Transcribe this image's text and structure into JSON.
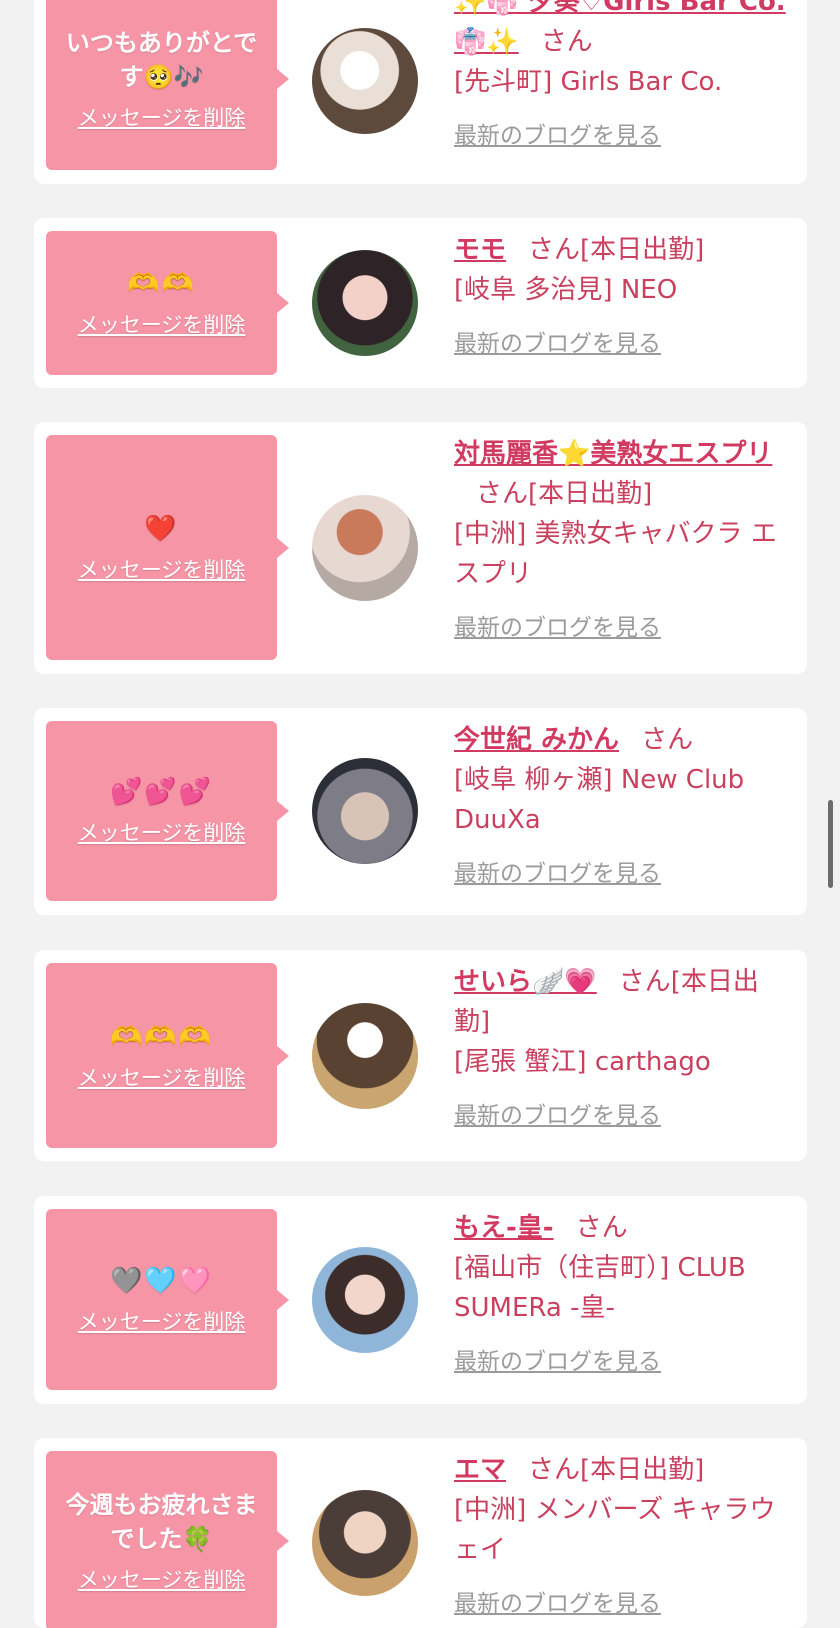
{
  "cards": [
    {
      "message": "いつもありがとです🥺🎶",
      "delete_label": "メッセージを削除",
      "name": "✨👘 夕葵♡Girls Bar Co.👘✨",
      "san": "さん",
      "status": "",
      "shop": "[先斗町] Girls Bar Co.",
      "blog": "最新のブログを見る"
    },
    {
      "message": "🫶🫶",
      "delete_label": "メッセージを削除",
      "name": "モモ",
      "san": "さん",
      "status": "[本日出勤]",
      "shop": "[岐阜 多治見] NEO",
      "blog": "最新のブログを見る"
    },
    {
      "message": "❤️",
      "delete_label": "メッセージを削除",
      "name": "対馬麗香⭐美熟女エスプリ",
      "san": "さん",
      "status": "[本日出勤]",
      "shop": "[中洲] 美熟女キャバクラ エスプリ",
      "blog": "最新のブログを見る"
    },
    {
      "message": "💕💕💕",
      "delete_label": "メッセージを削除",
      "name": "今世紀 みかん",
      "san": "さん",
      "status": "",
      "shop": "[岐阜 柳ヶ瀬] New Club DuuXa",
      "blog": "最新のブログを見る"
    },
    {
      "message": "🫶🫶🫶",
      "delete_label": "メッセージを削除",
      "name": "せいら🪽💗",
      "san": "さん",
      "status": "[本日出勤]",
      "shop": "[尾張 蟹江] carthago",
      "blog": "最新のブログを見る"
    },
    {
      "message": "🩶🩵🩷",
      "delete_label": "メッセージを削除",
      "name": "もえ-皇-",
      "san": "さん",
      "status": "",
      "shop": "[福山市（住吉町）] CLUB SUMERa -皇-",
      "blog": "最新のブログを見る"
    },
    {
      "message": "今週もお疲れさまでした🍀",
      "delete_label": "メッセージを削除",
      "name": "エマ",
      "san": "さん",
      "status": "[本日出勤]",
      "shop": "[中洲] メンバーズ キャラウェイ",
      "blog": "最新のブログを見る"
    }
  ],
  "colors": {
    "bubble": "#f595a6",
    "name": "#d13b62",
    "blog_link": "#9b9b9b",
    "background": "#f2f2f3"
  }
}
